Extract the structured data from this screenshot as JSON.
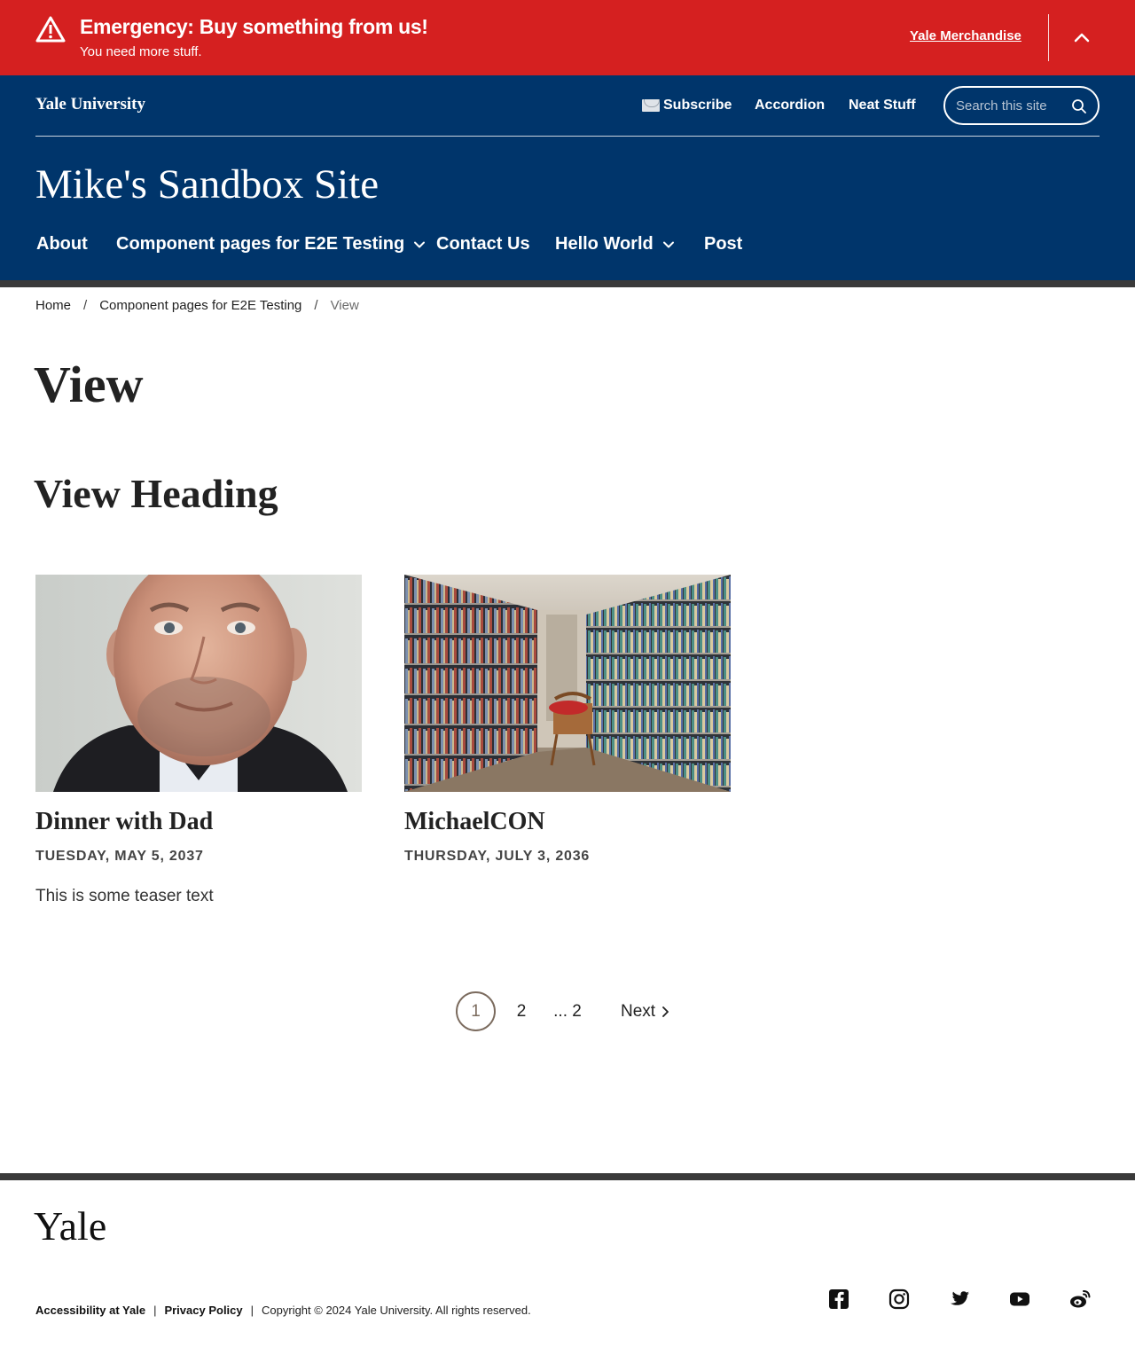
{
  "alert": {
    "title": "Emergency: Buy something from us!",
    "message": "You need more stuff.",
    "link_label": "Yale Merchandise",
    "icon": "warning-icon",
    "toggle_icon": "chevron-up-icon",
    "background": "#d52020"
  },
  "header": {
    "wordmark": "Yale University",
    "utility_links": [
      {
        "label": "Subscribe",
        "icon": "envelope-icon"
      },
      {
        "label": "Accordion"
      },
      {
        "label": "Neat Stuff"
      }
    ],
    "search": {
      "placeholder": "Search this site",
      "value": "",
      "icon": "search-icon"
    },
    "site_title": "Mike's Sandbox Site",
    "nav": [
      {
        "label": "About",
        "has_dropdown": false
      },
      {
        "label": "Component pages for E2E Testing",
        "has_dropdown": true
      },
      {
        "label": "Contact Us",
        "has_dropdown": false
      },
      {
        "label": "Hello World",
        "has_dropdown": true
      },
      {
        "label": "Post",
        "has_dropdown": false
      }
    ],
    "background": "#00356b"
  },
  "breadcrumb": {
    "items": [
      "Home",
      "Component pages for E2E Testing",
      "View"
    ],
    "separator": "/"
  },
  "page": {
    "title": "View",
    "view_heading": "View Heading"
  },
  "cards": [
    {
      "title": "Dinner with Dad",
      "date": "Tuesday, May 5, 2037",
      "teaser": "This is some teaser text",
      "image": "portrait-photo"
    },
    {
      "title": "MichaelCON",
      "date": "Thursday, July 3, 2036",
      "teaser": "",
      "image": "library-photo"
    }
  ],
  "pager": {
    "current": "1",
    "page_2": "2",
    "ellipsis": "... 2",
    "next_label": "Next"
  },
  "footer": {
    "logo": "Yale",
    "links": [
      "Accessibility at Yale",
      "Privacy Policy"
    ],
    "copyright": "Copyright © 2024 Yale University. All rights reserved.",
    "social": [
      "facebook-icon",
      "instagram-icon",
      "twitter-icon",
      "youtube-icon",
      "weibo-icon"
    ]
  }
}
